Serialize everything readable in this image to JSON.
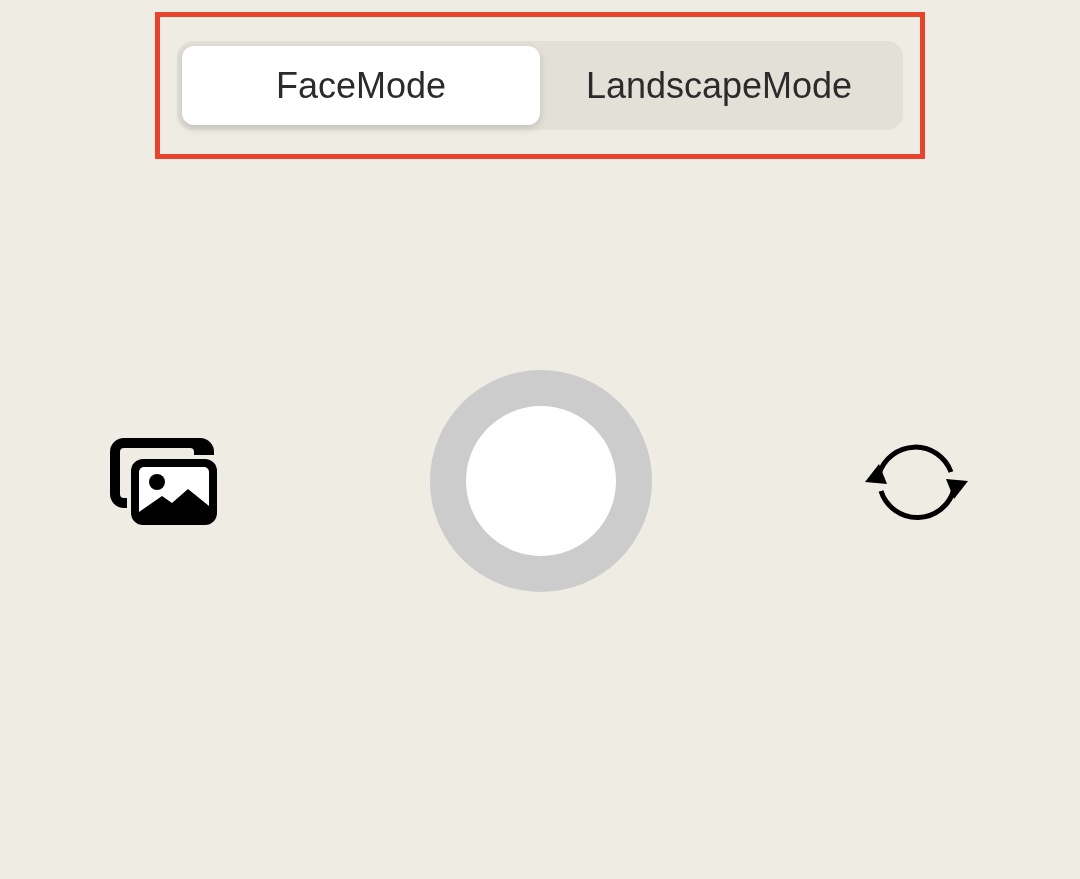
{
  "mode_switch": {
    "segments": [
      {
        "label": "FaceMode",
        "selected": true
      },
      {
        "label": "LandscapeMode",
        "selected": false
      }
    ]
  }
}
